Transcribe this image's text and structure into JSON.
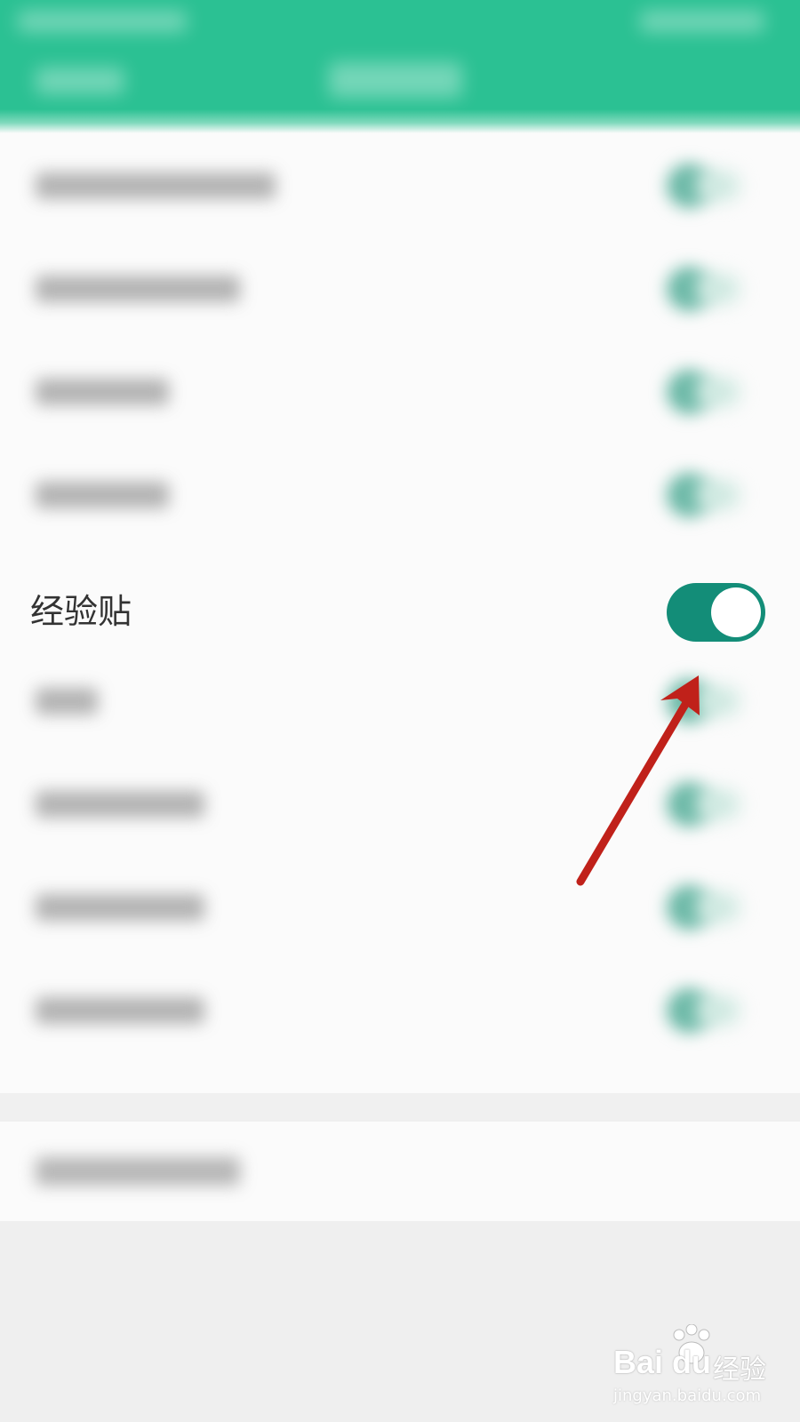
{
  "focused_setting": {
    "label": "经验贴",
    "enabled": true
  },
  "colors": {
    "header": "#2bc193",
    "toggle_on": "#138d78",
    "arrow": "#c0211a"
  },
  "watermark": {
    "brand": "Bai du",
    "product": "经验",
    "url": "jingyan.baidu.com"
  }
}
